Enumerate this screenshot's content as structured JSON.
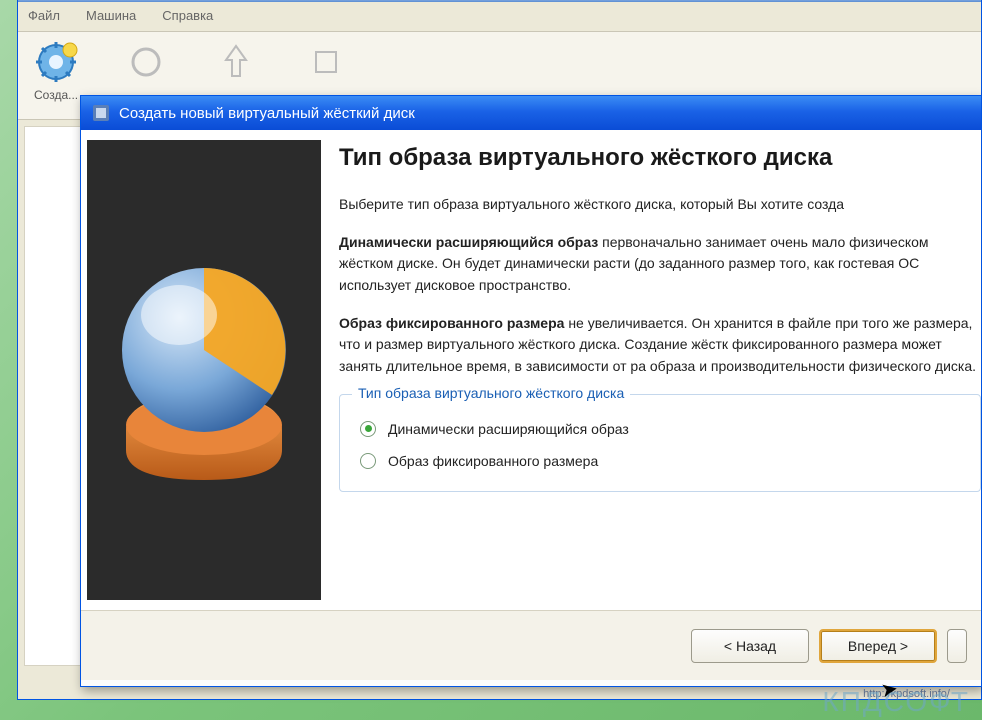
{
  "parent": {
    "menu": {
      "file": "Файл",
      "machine": "Машина",
      "help": "Справка"
    },
    "toolbar": {
      "create": "Созда..."
    }
  },
  "wizard": {
    "title": "Создать новый виртуальный жёсткий диск",
    "heading": "Тип образа виртуального жёсткого диска",
    "intro": "Выберите тип образа виртуального жёсткого диска, который Вы хотите созда",
    "dyn_bold": "Динамически расширяющийся образ",
    "dyn_text": " первоначально занимает очень мало физическом жёстком диске. Он будет динамически расти (до заданного размер того, как гостевая ОС использует дисковое пространство.",
    "fix_bold": "Образ фиксированного размера",
    "fix_text": " не увеличивается. Он хранится в файле при того же размера, что и размер виртуального жёсткого диска. Создание жёстк фиксированного размера может занять длительное время, в зависимости от ра образа и производительности физического диска.",
    "group_legend": "Тип образа виртуального жёсткого диска",
    "radio_dynamic": "Динамически расширяющийся образ",
    "radio_fixed": "Образ фиксированного размера",
    "selected": "dynamic",
    "buttons": {
      "back": "< Назад",
      "next": "Вперед >"
    }
  },
  "status_url": "http://kpdsoft.info/",
  "watermark": "КПДСОФТ"
}
